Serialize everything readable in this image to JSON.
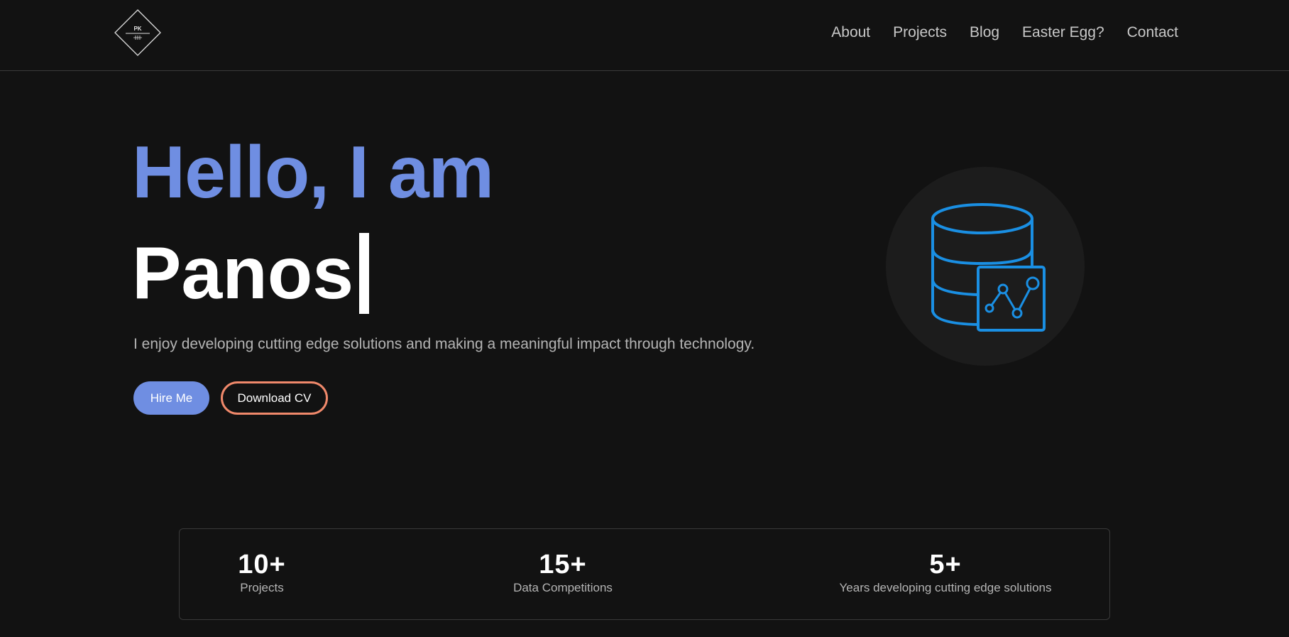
{
  "brand": {
    "monogram": "PK",
    "icon": "diamond-monogram-logo"
  },
  "nav": {
    "links": [
      "About",
      "Projects",
      "Blog",
      "Easter Egg?",
      "Contact"
    ]
  },
  "hero": {
    "greeting": "Hello, I am",
    "name": "Panos",
    "tagline": "I enjoy developing cutting edge solutions and making a meaningful impact through technology.",
    "hire_label": "Hire Me",
    "cv_label": "Download CV",
    "illustration_icon": "database-chart-icon"
  },
  "stats": [
    {
      "value": "10+",
      "label": "Projects"
    },
    {
      "value": "15+",
      "label": "Data Competitions"
    },
    {
      "value": "5+",
      "label": "Years developing cutting edge solutions"
    }
  ],
  "colors": {
    "background": "#121212",
    "accent_blue": "#6f8ee2",
    "accent_orange": "#f0896b",
    "icon_blue": "#1a8fe3"
  }
}
